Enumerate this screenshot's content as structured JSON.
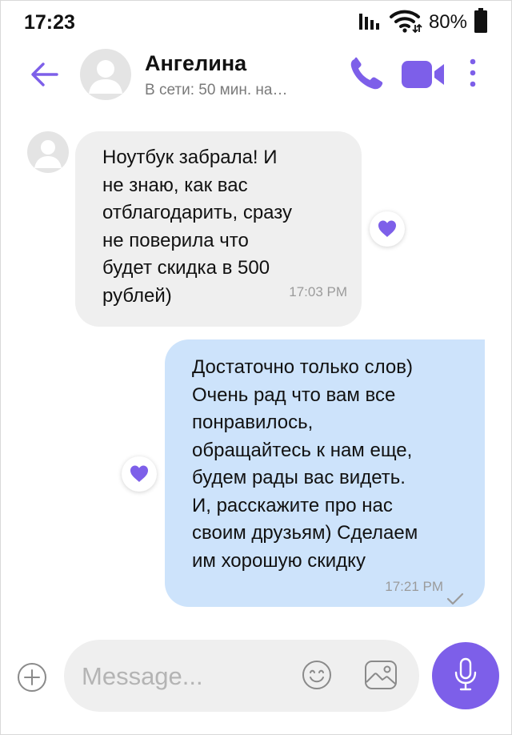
{
  "status_bar": {
    "time": "17:23",
    "battery": "80%",
    "icons": [
      "signal-icon",
      "wifi-icon",
      "battery-icon"
    ]
  },
  "header": {
    "contact_name": "Ангелина",
    "contact_status": "В сети: 50 мин. на…",
    "actions": [
      "back-arrow-icon",
      "phone-icon",
      "video-camera-icon",
      "more-vertical-icon"
    ]
  },
  "messages": [
    {
      "direction": "incoming",
      "text": "Ноутбук забрала! И\nне знаю, как вас\nотблагодарить, сразу\nне поверила что\nбудет скидка в 500\nрублей)",
      "time": "17:03 PM",
      "reaction": "heart-icon"
    },
    {
      "direction": "outgoing",
      "text": "Достаточно только слов)\nОчень рад что вам все\nпонравилось,\nобращайтесь к нам еще,\nбудем рады вас видеть.\nИ, расскажите про нас\nсвоим друзьям) Сделаем\nим хорошую скидку",
      "time": "17:21 PM",
      "reaction": "heart-icon",
      "status_icon": "checkmark-icon"
    }
  ],
  "composer": {
    "placeholder": "Message...",
    "value": "",
    "icons": [
      "plus-circle-icon",
      "emoji-icon",
      "gallery-icon",
      "microphone-icon"
    ]
  },
  "colors": {
    "accent": "#7d5fe9",
    "incoming_bubble": "#efefef",
    "outgoing_bubble": "#cde3fb",
    "secondary_text": "#9b9b9b"
  }
}
